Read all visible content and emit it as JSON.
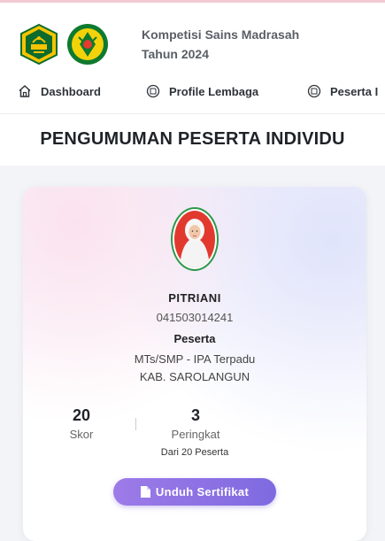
{
  "header": {
    "title_line1": "Kompetisi Sains Madrasah",
    "title_line2": "Tahun 2024"
  },
  "nav": {
    "items": [
      {
        "label": "Dashboard",
        "icon": "home-icon"
      },
      {
        "label": "Profile Lembaga",
        "icon": "page-icon"
      },
      {
        "label": "Peserta I",
        "icon": "page-icon"
      }
    ]
  },
  "page": {
    "title": "PENGUMUMAN PESERTA INDIVIDU"
  },
  "participant": {
    "name": "PITRIANI",
    "number": "041503014241",
    "role": "Peserta",
    "school": "MTs/SMP - IPA Terpadu",
    "region": "KAB. SAROLANGUN"
  },
  "stats": {
    "score_value": "20",
    "score_label": "Skor",
    "rank_value": "3",
    "rank_label": "Peringkat",
    "rank_note": "Dari 20 Peserta"
  },
  "actions": {
    "download_label": "Unduh Sertifikat"
  },
  "colors": {
    "accent": "#8b72e4",
    "avatar_ring": "#2f9a4b",
    "avatar_bg": "#e2392f"
  }
}
